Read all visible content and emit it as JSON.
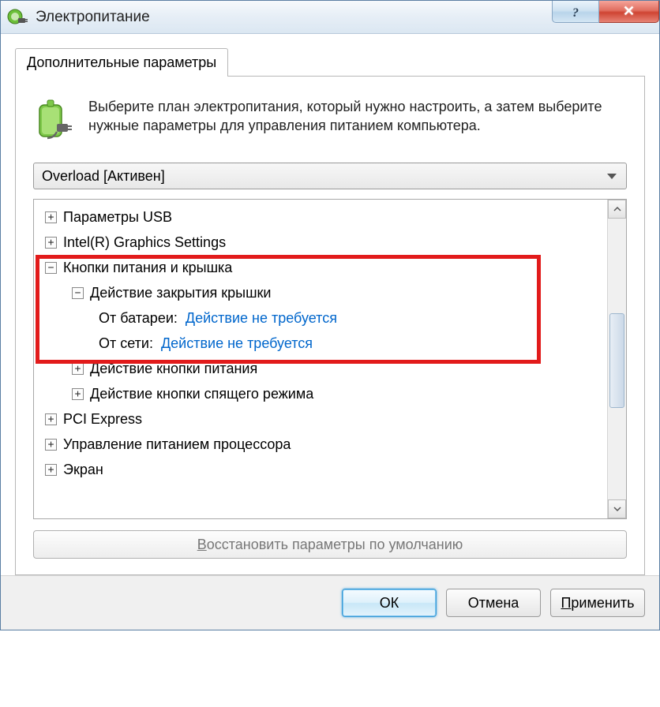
{
  "window": {
    "title": "Электропитание"
  },
  "tab": {
    "label": "Дополнительные параметры"
  },
  "intro": {
    "text": "Выберите план электропитания, который нужно настроить, а затем выберите нужные параметры для управления питанием компьютера."
  },
  "plan": {
    "selected": "Overload [Активен]"
  },
  "tree": {
    "usb": "Параметры USB",
    "graphics": "Intel(R) Graphics Settings",
    "power_lid": "Кнопки питания и крышка",
    "lid_action": "Действие закрытия крышки",
    "battery_label": "От батареи:",
    "battery_value": "Действие не требуется",
    "plugged_label": "От сети:",
    "plugged_value": "Действие не требуется",
    "power_button": "Действие кнопки питания",
    "sleep_button": "Действие кнопки спящего режима",
    "pci": "PCI Express",
    "cpu": "Управление питанием процессора",
    "screen": "Экран"
  },
  "restore": {
    "prefix": "В",
    "rest": "осстановить параметры по умолчанию"
  },
  "buttons": {
    "ok": "ОК",
    "cancel": "Отмена",
    "apply_u": "П",
    "apply_rest": "рименить"
  }
}
